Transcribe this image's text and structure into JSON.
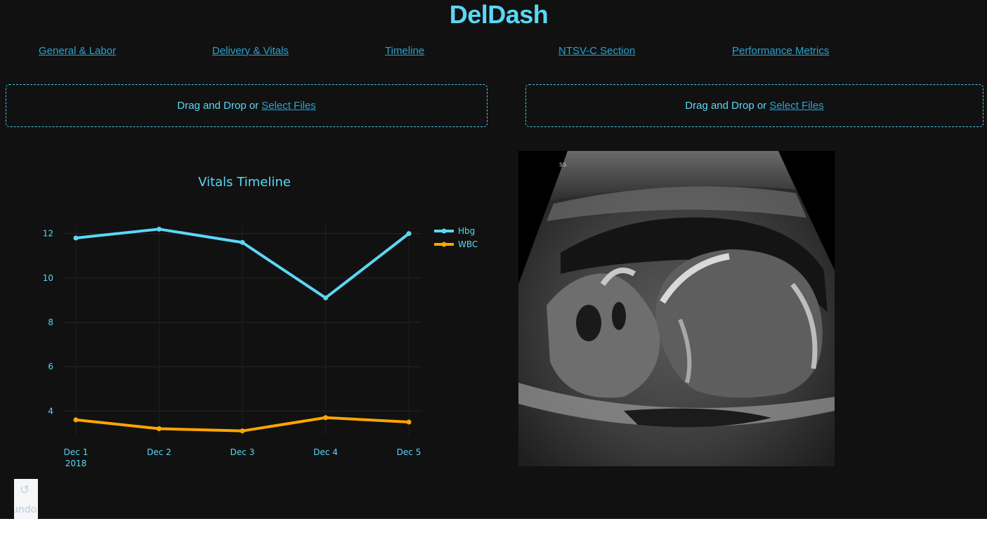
{
  "app": {
    "title": "DelDash"
  },
  "nav": {
    "items": [
      {
        "label": "General & Labor"
      },
      {
        "label": "Delivery & Vitals"
      },
      {
        "label": "Timeline"
      },
      {
        "label": "NTSV-C Section"
      },
      {
        "label": "Performance Metrics"
      }
    ]
  },
  "uploads": [
    {
      "text": "Drag and Drop or",
      "link": "Select Files"
    },
    {
      "text": "Drag and Drop or",
      "link": "Select Files"
    }
  ],
  "undo": {
    "label": "undo",
    "icon": "undo-icon"
  },
  "colors": {
    "background": "#111111",
    "accent": "#5ad8f5",
    "link": "#2aa3cf",
    "hbg": "#5ad8f5",
    "wbc": "#ffa500"
  },
  "chart_data": {
    "type": "line",
    "title": "Vitals Timeline",
    "x": [
      "Dec 1",
      "Dec 2",
      "Dec 3",
      "Dec 4",
      "Dec 5"
    ],
    "x_year": "2018",
    "series": [
      {
        "name": "Hbg",
        "values": [
          11.8,
          12.2,
          11.6,
          9.1,
          12.0
        ],
        "color": "#5ad8f5"
      },
      {
        "name": "WBC",
        "values": [
          3.6,
          3.2,
          3.1,
          3.7,
          3.5
        ],
        "color": "#ffa500"
      }
    ],
    "yticks": [
      4,
      6,
      8,
      10,
      12
    ],
    "ylim": [
      2.9,
      12.4
    ],
    "xlabel": "",
    "ylabel": "",
    "grid": true,
    "legend": "top-right"
  }
}
